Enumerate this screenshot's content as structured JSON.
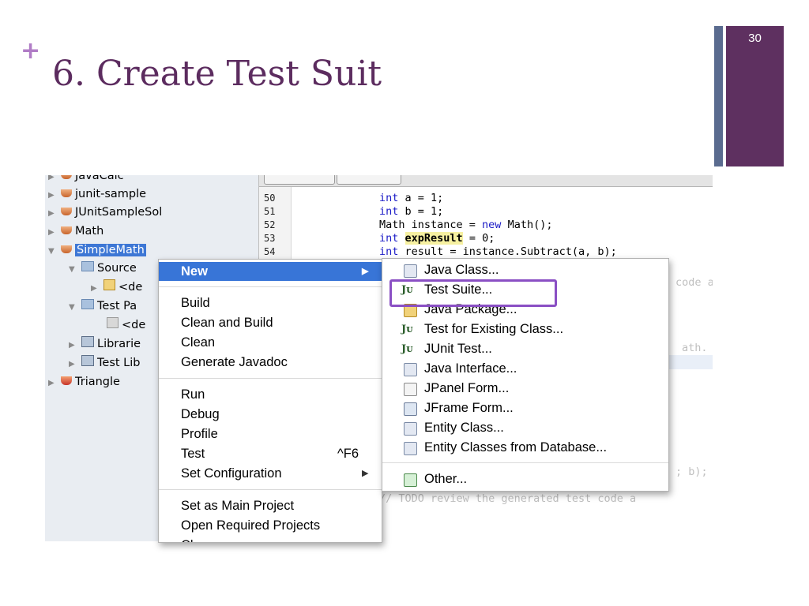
{
  "slide": {
    "plus": "+",
    "title": "6. Create Test Suit",
    "number": "30",
    "accent_color": "#5e3060",
    "highlight_color": "#8a4fc4"
  },
  "tree": {
    "items": [
      {
        "label": "JavaCalc",
        "icon": "project-icon"
      },
      {
        "label": "junit-sample",
        "icon": "project-icon"
      },
      {
        "label": "JUnitSampleSol",
        "icon": "project-icon"
      },
      {
        "label": "Math",
        "icon": "project-icon"
      },
      {
        "label": "SimpleMath",
        "icon": "project-icon"
      },
      {
        "label": "Source",
        "icon": "folder-icon"
      },
      {
        "label": "<de",
        "icon": "package-icon"
      },
      {
        "label": "Test Pa",
        "icon": "folder-icon"
      },
      {
        "label": "<de",
        "icon": "package-icon"
      },
      {
        "label": "Librarie",
        "icon": "library-icon"
      },
      {
        "label": "Test Lib",
        "icon": "library-icon"
      },
      {
        "label": "Triangle",
        "icon": "project-icon"
      }
    ]
  },
  "editor": {
    "line_numbers": [
      "50",
      "51",
      "52",
      "53",
      "54"
    ],
    "lines": [
      {
        "pre": "int",
        "rest": " a = 1;"
      },
      {
        "pre": "int",
        "rest": " b = 1;"
      },
      {
        "pre": "Math instance = ",
        "kw": "new",
        "rest": " Math();"
      },
      {
        "pre": "int",
        "hl": "expResult",
        "rest": " = 0;"
      },
      {
        "pre": "int",
        "rest": " result = instance.Subtract(a, b);"
      }
    ],
    "faded_fragments": {
      "code_a": "code a",
      "math": "ath.",
      "multiply": "; b);",
      "todo": "// TODO review the generated test code a"
    }
  },
  "context_menu": {
    "items": [
      {
        "label": "New",
        "active": true,
        "submenu": true
      },
      {
        "label": "Build"
      },
      {
        "label": "Clean and Build"
      },
      {
        "label": "Clean"
      },
      {
        "label": "Generate Javadoc"
      },
      {
        "label": "Run"
      },
      {
        "label": "Debug"
      },
      {
        "label": "Profile"
      },
      {
        "label": "Test",
        "shortcut": "^F6"
      },
      {
        "label": "Set Configuration",
        "submenu": true
      },
      {
        "label": "Set as Main Project"
      },
      {
        "label": "Open Required Projects"
      },
      {
        "label": "Cl"
      }
    ]
  },
  "submenu": {
    "items": [
      {
        "label": "Java Class...",
        "icon": "java-class-icon"
      },
      {
        "label": "Test Suite...",
        "icon": "junit-icon"
      },
      {
        "label": "Java Package...",
        "icon": "package-icon"
      },
      {
        "label": "Test for Existing Class...",
        "icon": "junit-icon"
      },
      {
        "label": "JUnit Test...",
        "icon": "junit-icon"
      },
      {
        "label": "Java Interface...",
        "icon": "java-interface-icon"
      },
      {
        "label": "JPanel Form...",
        "icon": "jpanel-icon"
      },
      {
        "label": "JFrame Form...",
        "icon": "jframe-icon"
      },
      {
        "label": "Entity Class...",
        "icon": "entity-icon"
      },
      {
        "label": "Entity Classes from Database...",
        "icon": "entity-icon"
      },
      {
        "label": "Other...",
        "icon": "other-icon"
      }
    ],
    "junit_glyph": "Jᴜ"
  }
}
